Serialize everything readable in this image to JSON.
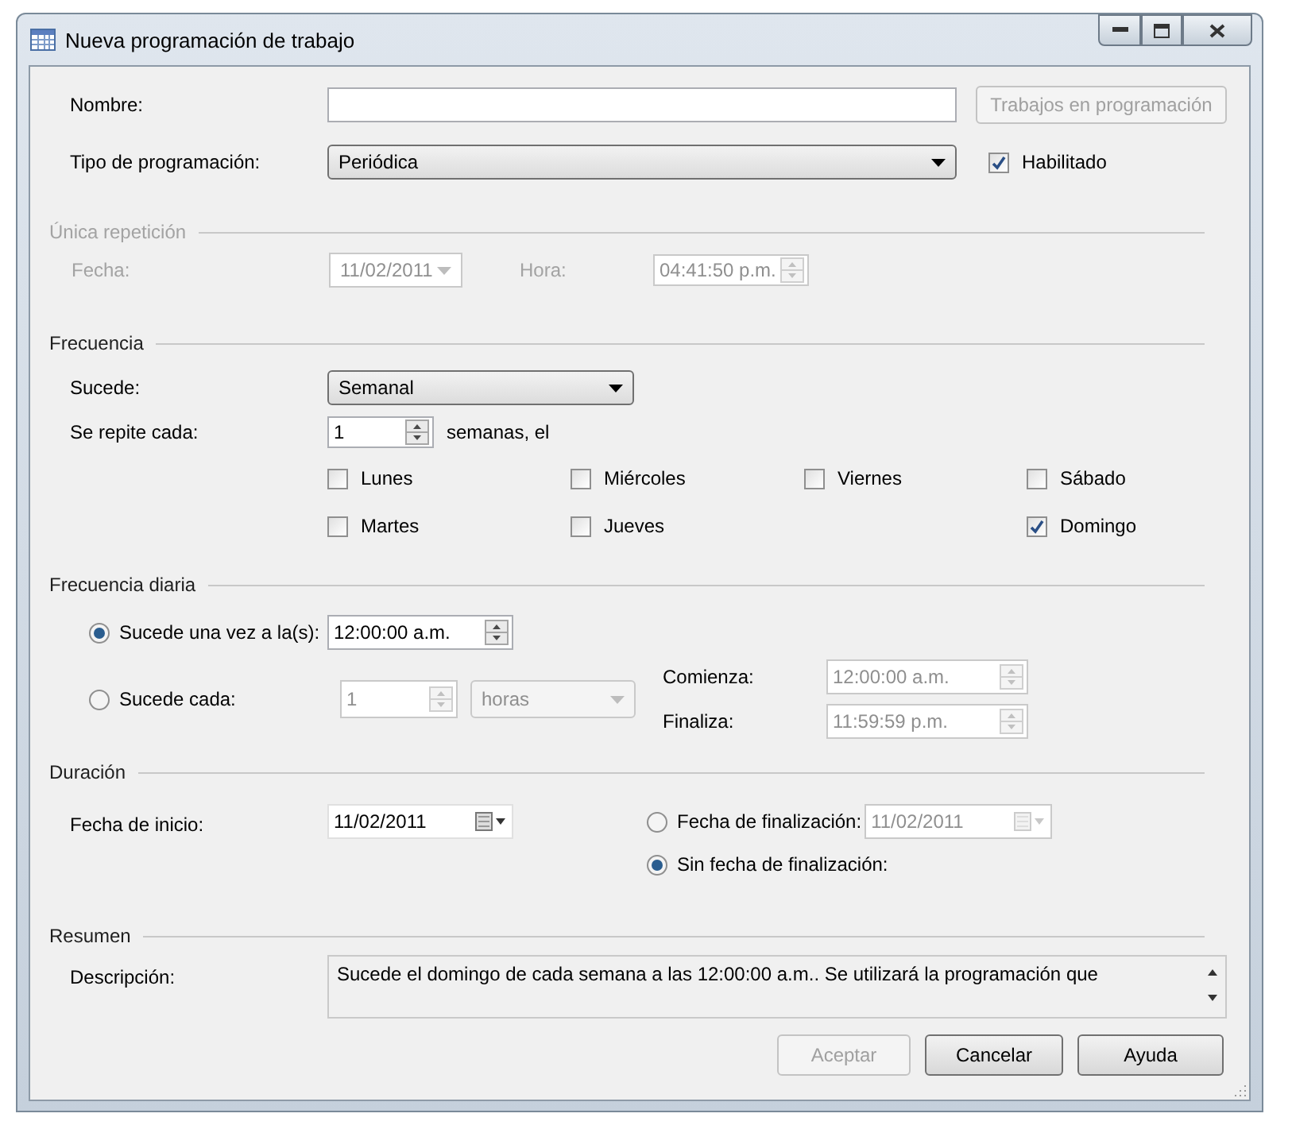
{
  "window": {
    "title": "Nueva programación de trabajo"
  },
  "name_row": {
    "label": "Nombre:"
  },
  "jobs_button": {
    "label": "Trabajos en programación",
    "disabled": true
  },
  "schedule_type": {
    "label": "Tipo de programación:",
    "value": "Periódica"
  },
  "enabled": {
    "label": "Habilitado",
    "checked": true
  },
  "one_time": {
    "title": "Única repetición",
    "disabled": true,
    "date_label": "Fecha:",
    "date": "11/02/2011",
    "time_label": "Hora:",
    "time": "04:41:50 p.m."
  },
  "frequency": {
    "title": "Frecuencia",
    "occurs_label": "Sucede:",
    "occurs": "Semanal",
    "repeat_label": "Se repite cada:",
    "repeat_value": "1",
    "repeat_unit": "semanas, el",
    "day_columns": [
      [
        {
          "label": "Lunes",
          "checked": false
        },
        {
          "label": "Martes",
          "checked": false
        }
      ],
      [
        {
          "label": "Miércoles",
          "checked": false
        },
        {
          "label": "Jueves",
          "checked": false
        }
      ],
      [
        {
          "label": "Viernes",
          "checked": false
        }
      ],
      [
        {
          "label": "Sábado",
          "checked": false
        },
        {
          "label": "Domingo",
          "checked": true
        }
      ]
    ]
  },
  "daily": {
    "title": "Frecuencia diaria",
    "once": {
      "label": "Sucede una vez a la(s):",
      "selected": true,
      "time": "12:00:00 a.m."
    },
    "every": {
      "label": "Sucede cada:",
      "selected": false,
      "value": "1",
      "unit": "horas",
      "start_label": "Comienza:",
      "start": "12:00:00 a.m.",
      "end_label": "Finaliza:",
      "end": "11:59:59 p.m."
    }
  },
  "duration": {
    "title": "Duración",
    "start_label": "Fecha de inicio:",
    "start": "11/02/2011",
    "end_options": [
      {
        "kind": "date",
        "label": "Fecha de finalización:",
        "selected": false,
        "date": "11/02/2011"
      },
      {
        "kind": "none",
        "label": "Sin fecha de finalización:",
        "selected": true
      }
    ]
  },
  "summary": {
    "title": "Resumen",
    "label": "Descripción:",
    "text": "Sucede el domingo de cada semana a las 12:00:00 a.m.. Se utilizará la programación que"
  },
  "buttons": [
    {
      "label": "Aceptar",
      "disabled": true
    },
    {
      "label": "Cancelar",
      "disabled": false
    },
    {
      "label": "Ayuda",
      "disabled": false
    }
  ]
}
